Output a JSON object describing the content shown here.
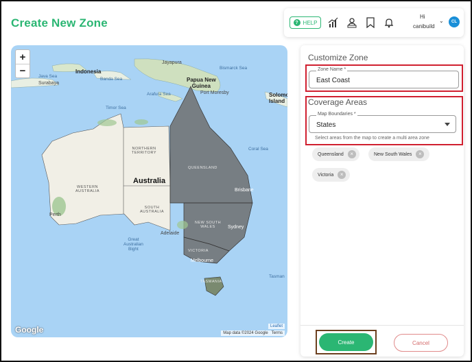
{
  "page": {
    "title": "Create New Zone"
  },
  "topbar": {
    "help_label": "HELP",
    "icons": [
      "chart-icon",
      "user-badge-icon",
      "bookmark-icon",
      "bell-icon"
    ],
    "user_greeting": "Hi",
    "user_name": "canibuild",
    "avatar_initials": "CL"
  },
  "map": {
    "zoom_in": "+",
    "zoom_out": "−",
    "country_label": "Australia",
    "state_labels": {
      "nt": "NORTHERN\nTERRITORY",
      "wa": "WESTERN\nAUSTRALIA",
      "sa": "SOUTH\nAUSTRALIA",
      "qld": "QUEENSLAND",
      "nsw": "NEW SOUTH\nWALES",
      "vic": "VICTORIA",
      "tas": "TASMANIA"
    },
    "places": {
      "indonesia": "Indonesia",
      "java_sea": "Java Sea",
      "surabaya": "Surabaya",
      "banda_sea": "Banda Sea",
      "jayapura": "Jayapura",
      "bismarck_sea": "Bismarck Sea",
      "papua": "Papua New\nGuinea",
      "port_moresby": "Port Moresby",
      "arafura_sea": "Arafura Sea",
      "timor_sea": "Timor Sea",
      "solomon": "Solomo\nIsland",
      "coral_sea": "Coral Sea",
      "perth": "Perth",
      "brisbane": "Brisbane",
      "sydney": "Sydney",
      "adelaide": "Adelaide",
      "melbourne": "Melbourne",
      "bight": "Great\nAustralian\nBight",
      "tasman": "Tasman"
    },
    "google_logo": "Google",
    "attribution": "Map data ©2024 Google",
    "terms": "Terms",
    "leaflet": "Leaflet",
    "highlight_color": "#6f6f6f"
  },
  "panel": {
    "customize_title": "Customize Zone",
    "zone_name_label": "Zone Name *",
    "zone_name_value": "East Coast",
    "coverage_title": "Coverage Areas",
    "boundaries_label": "Map Boundaries *",
    "boundaries_value": "States",
    "helper_text": "Select areas from the map to create a multi area zone",
    "chips": [
      "Queensland",
      "New South Wales",
      "Victoria"
    ],
    "create_label": "Create",
    "cancel_label": "Cancel"
  },
  "colors": {
    "brand_green": "#2bb673",
    "highlight_red": "#d01f2f",
    "cancel_red": "#d46a6a"
  }
}
